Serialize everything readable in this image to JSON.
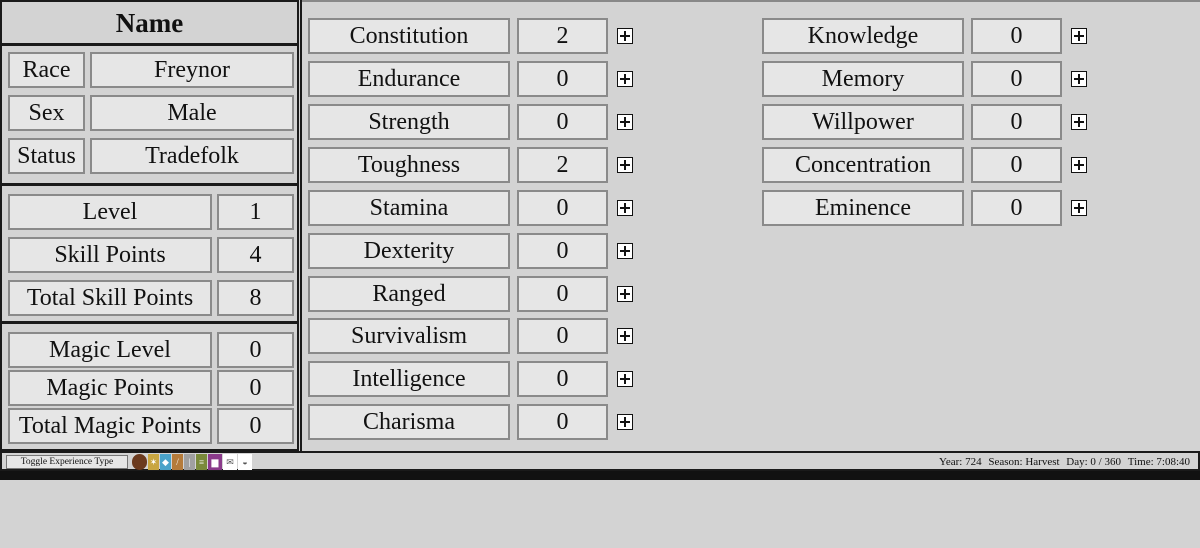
{
  "character": {
    "name_label": "Name",
    "race_label": "Race",
    "race_value": "Freynor",
    "sex_label": "Sex",
    "sex_value": "Male",
    "status_label": "Status",
    "status_value": "Tradefolk"
  },
  "progress": {
    "level_label": "Level",
    "level_value": "1",
    "skill_points_label": "Skill Points",
    "skill_points_value": "4",
    "total_skill_points_label": "Total Skill Points",
    "total_skill_points_value": "8"
  },
  "magic": {
    "magic_level_label": "Magic Level",
    "magic_level_value": "0",
    "magic_points_label": "Magic Points",
    "magic_points_value": "0",
    "total_magic_points_label": "Total Magic Points",
    "total_magic_points_value": "0"
  },
  "stats_left": [
    {
      "label": "Constitution",
      "value": "2"
    },
    {
      "label": "Endurance",
      "value": "0"
    },
    {
      "label": "Strength",
      "value": "0"
    },
    {
      "label": "Toughness",
      "value": "2"
    },
    {
      "label": "Stamina",
      "value": "0"
    },
    {
      "label": "Dexterity",
      "value": "0"
    },
    {
      "label": "Ranged",
      "value": "0"
    },
    {
      "label": "Survivalism",
      "value": "0"
    },
    {
      "label": "Intelligence",
      "value": "0"
    },
    {
      "label": "Charisma",
      "value": "0"
    }
  ],
  "stats_right": [
    {
      "label": "Knowledge",
      "value": "0"
    },
    {
      "label": "Memory",
      "value": "0"
    },
    {
      "label": "Willpower",
      "value": "0"
    },
    {
      "label": "Concentration",
      "value": "0"
    },
    {
      "label": "Eminence",
      "value": "0"
    }
  ],
  "bottom_bar": {
    "toggle_label": "Toggle Experience Type",
    "icons": [
      {
        "name": "creature-icon",
        "color": "#6b3a1e"
      },
      {
        "name": "figure-icon",
        "color": "#c9a640"
      },
      {
        "name": "crystal-icon",
        "color": "#4aa3c9"
      },
      {
        "name": "torch-icon",
        "color": "#b57b3a"
      },
      {
        "name": "blade-icon",
        "color": "#a0a0a0"
      },
      {
        "name": "scroll-icon",
        "color": "#7a8a3a"
      },
      {
        "name": "chest-icon",
        "color": "#8a3a8a"
      },
      {
        "name": "letter-icon",
        "color": "#ffffff"
      },
      {
        "name": "pouch-icon",
        "color": "#ffffff"
      }
    ],
    "year": "Year: 724",
    "season": "Season: Harvest",
    "day": "Day: 0 / 360",
    "time": "Time: 7:08:40"
  }
}
